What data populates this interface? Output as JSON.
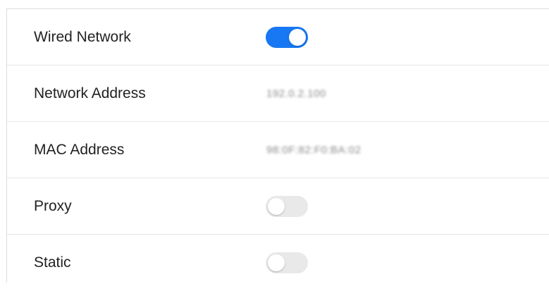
{
  "settings": {
    "rows": [
      {
        "label": "Wired Network",
        "type": "toggle",
        "enabled": true
      },
      {
        "label": "Network Address",
        "type": "value",
        "value": "192.0.2.100"
      },
      {
        "label": "MAC Address",
        "type": "value",
        "value": "98:0F:82:F0:BA:02"
      },
      {
        "label": "Proxy",
        "type": "toggle",
        "enabled": false
      },
      {
        "label": "Static",
        "type": "toggle",
        "enabled": false
      }
    ]
  },
  "colors": {
    "toggle_on": "#1877f2",
    "toggle_off": "#e9e9e9"
  }
}
